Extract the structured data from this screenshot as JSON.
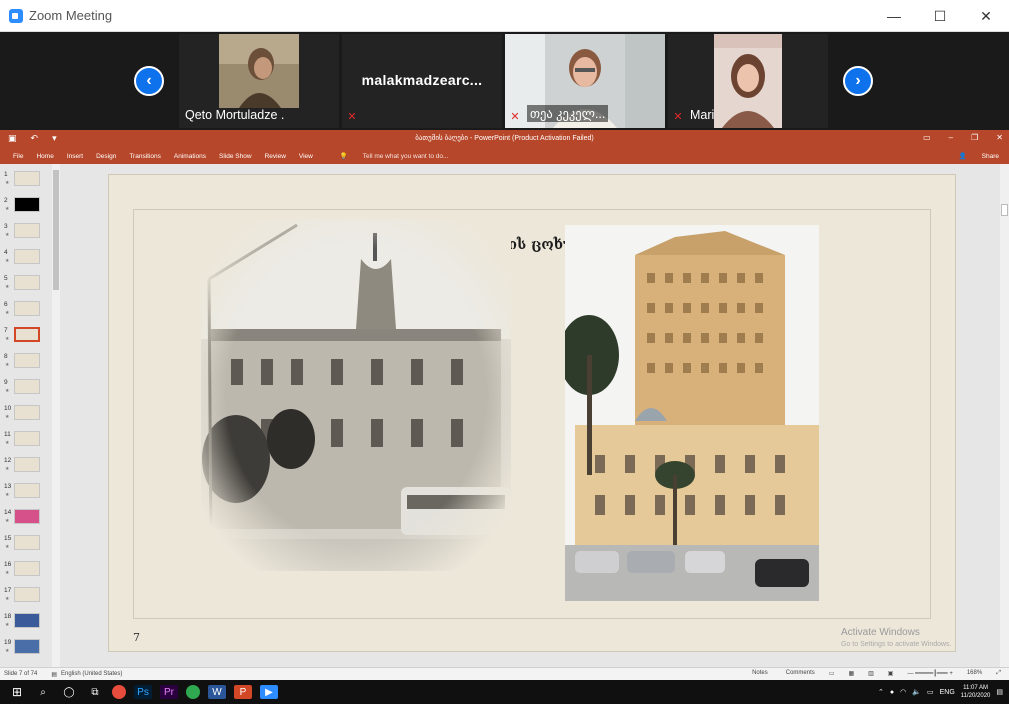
{
  "window": {
    "title": "Zoom Meeting"
  },
  "participants": [
    {
      "name": "Qeto Mortuladze ."
    },
    {
      "name": "malakmadzearc..."
    },
    {
      "name": "თეა კეკელ..."
    },
    {
      "name": "Mari"
    }
  ],
  "ppt": {
    "doc_title": "ბათუმის ბაღები - PowerPoint (Product Activation Failed)",
    "share_label": "Share",
    "tabs": [
      "File",
      "Home",
      "Insert",
      "Design",
      "Transitions",
      "Animations",
      "Slide Show",
      "Review",
      "View"
    ],
    "tell_me": "Tell me what you want to do...",
    "slide_heading": "ბათუმის ცოხუმა",
    "slide_page": "7",
    "thumbnails": [
      "1",
      "2",
      "3",
      "4",
      "5",
      "6",
      "7",
      "8",
      "9",
      "10",
      "11",
      "12",
      "13",
      "14",
      "15",
      "16",
      "17",
      "18",
      "19"
    ],
    "status_slide": "Slide 7 of 74",
    "status_lang": "English (United States)",
    "status_notes": "Notes",
    "status_comments": "Comments",
    "zoom_level": "168%",
    "activate_title": "Activate Windows",
    "activate_sub": "Go to Settings to activate Windows."
  },
  "taskbar": {
    "lang": "ENG",
    "time": "11:07 AM",
    "date": "11/20/2020"
  },
  "colors": {
    "ppt_accent": "#b7472a",
    "zoom_blue": "#0e72ed",
    "mic_muted": "#e02828"
  }
}
